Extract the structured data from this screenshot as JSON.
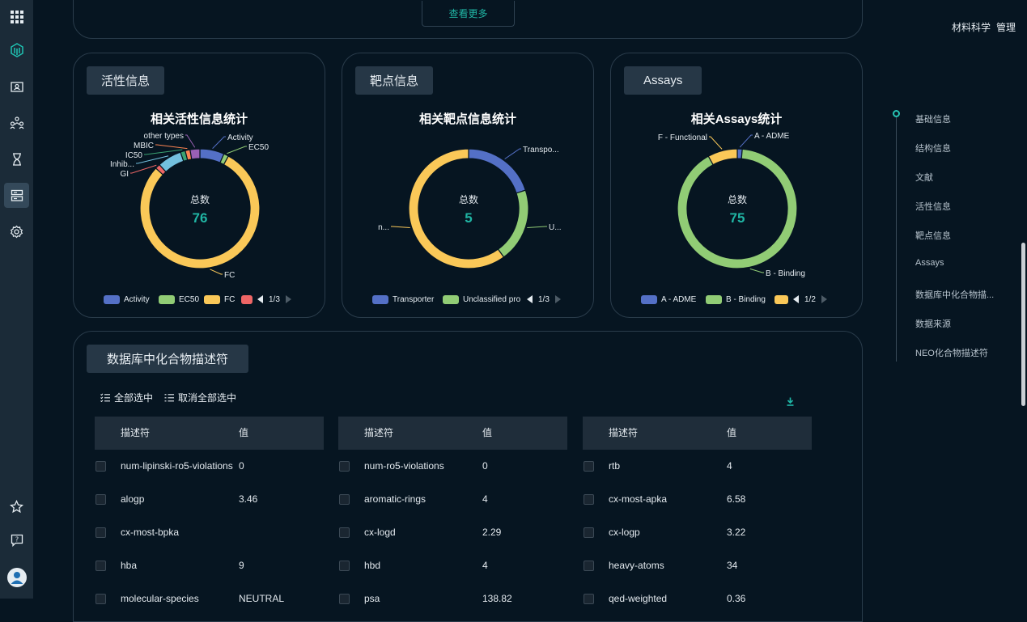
{
  "sidebar": {
    "icons": [
      "apps-grid-icon",
      "cube-logo-icon",
      "contact-card-icon",
      "network-icon",
      "hourglass-icon",
      "database-icon",
      "settings-icon",
      "star-icon",
      "feedback-icon",
      "user-avatar-icon"
    ]
  },
  "top_right": {
    "items": [
      "材料科学",
      "管理"
    ]
  },
  "more_button": {
    "label": "查看更多"
  },
  "activity_card": {
    "tag": "活性信息",
    "title": "相关活性信息统计",
    "center_label": "总数",
    "center_value": "76",
    "pager": "1/3",
    "legend": [
      {
        "label": "Activity",
        "color": "#5470c6"
      },
      {
        "label": "EC50",
        "color": "#91cc75"
      },
      {
        "label": "FC",
        "color": "#fac858"
      },
      {
        "label": "",
        "color": "#ee6666"
      }
    ],
    "slice_labels": [
      "Activity",
      "EC50",
      "FC",
      "GI",
      "Inhib...",
      "IC50",
      "MBIC",
      "other types"
    ]
  },
  "target_card": {
    "tag": "靶点信息",
    "title": "相关靶点信息统计",
    "center_label": "总数",
    "center_value": "5",
    "pager": "1/3",
    "legend": [
      {
        "label": "Transporter",
        "color": "#5470c6"
      },
      {
        "label": "Unclassified pro",
        "color": "#91cc75"
      }
    ],
    "slice_labels": [
      "Transpo...",
      "U...",
      "n..."
    ]
  },
  "assays_card": {
    "tag": "Assays",
    "title": "相关Assays统计",
    "center_label": "总数",
    "center_value": "75",
    "pager": "1/2",
    "legend": [
      {
        "label": "A - ADME",
        "color": "#5470c6"
      },
      {
        "label": "B - Binding",
        "color": "#91cc75"
      },
      {
        "label": "",
        "color": "#fac858"
      }
    ],
    "slice_labels": [
      "A - ADME",
      "B - Binding",
      "F - Functional"
    ]
  },
  "chart_data": [
    {
      "type": "pie",
      "title": "相关活性信息统计",
      "total": 76,
      "slices": [
        {
          "name": "Activity",
          "value": 5,
          "color": "#5470c6"
        },
        {
          "name": "EC50",
          "value": 1,
          "color": "#91cc75"
        },
        {
          "name": "FC",
          "value": 60,
          "color": "#fac858"
        },
        {
          "name": "GI",
          "value": 1,
          "color": "#ee6666"
        },
        {
          "name": "Inhib...",
          "value": 5,
          "color": "#73c0de"
        },
        {
          "name": "IC50",
          "value": 1,
          "color": "#3ba272"
        },
        {
          "name": "MBIC",
          "value": 1,
          "color": "#fc8452"
        },
        {
          "name": "other types",
          "value": 2,
          "color": "#9a60b4"
        }
      ]
    },
    {
      "type": "pie",
      "title": "相关靶点信息统计",
      "total": 5,
      "slices": [
        {
          "name": "Transpo...",
          "value": 1,
          "color": "#5470c6"
        },
        {
          "name": "U...",
          "value": 1,
          "color": "#91cc75"
        },
        {
          "name": "n...",
          "value": 3,
          "color": "#fac858"
        }
      ]
    },
    {
      "type": "pie",
      "title": "相关Assays统计",
      "total": 75,
      "slices": [
        {
          "name": "A - ADME",
          "value": 1,
          "color": "#5470c6"
        },
        {
          "name": "B - Binding",
          "value": 68,
          "color": "#91cc75"
        },
        {
          "name": "F - Functional",
          "value": 6,
          "color": "#fac858"
        }
      ]
    }
  ],
  "descriptors": {
    "tag": "数据库中化合物描述符",
    "select_all": "全部选中",
    "deselect_all": "取消全部选中",
    "col_name": "描述符",
    "col_value": "值",
    "tables": [
      [
        {
          "name": "num-lipinski-ro5-violations",
          "value": "0"
        },
        {
          "name": "alogp",
          "value": "3.46"
        },
        {
          "name": "cx-most-bpka",
          "value": ""
        },
        {
          "name": "hba",
          "value": "9"
        },
        {
          "name": "molecular-species",
          "value": "NEUTRAL"
        }
      ],
      [
        {
          "name": "num-ro5-violations",
          "value": "0"
        },
        {
          "name": "aromatic-rings",
          "value": "4"
        },
        {
          "name": "cx-logd",
          "value": "2.29"
        },
        {
          "name": "hbd",
          "value": "4"
        },
        {
          "name": "psa",
          "value": "138.82"
        }
      ],
      [
        {
          "name": "rtb",
          "value": "4"
        },
        {
          "name": "cx-most-apka",
          "value": "6.58"
        },
        {
          "name": "cx-logp",
          "value": "3.22"
        },
        {
          "name": "heavy-atoms",
          "value": "34"
        },
        {
          "name": "qed-weighted",
          "value": "0.36"
        }
      ]
    ]
  },
  "anchor_nav": {
    "items": [
      "基础信息",
      "结构信息",
      "文献",
      "活性信息",
      "靶点信息",
      "Assays",
      "数据库中化合物描...",
      "数据来源",
      "NEO化合物描述符"
    ]
  },
  "colors": {
    "accent": "#26c3b3",
    "background": "#061521",
    "sidebar": "#1b2b38"
  }
}
